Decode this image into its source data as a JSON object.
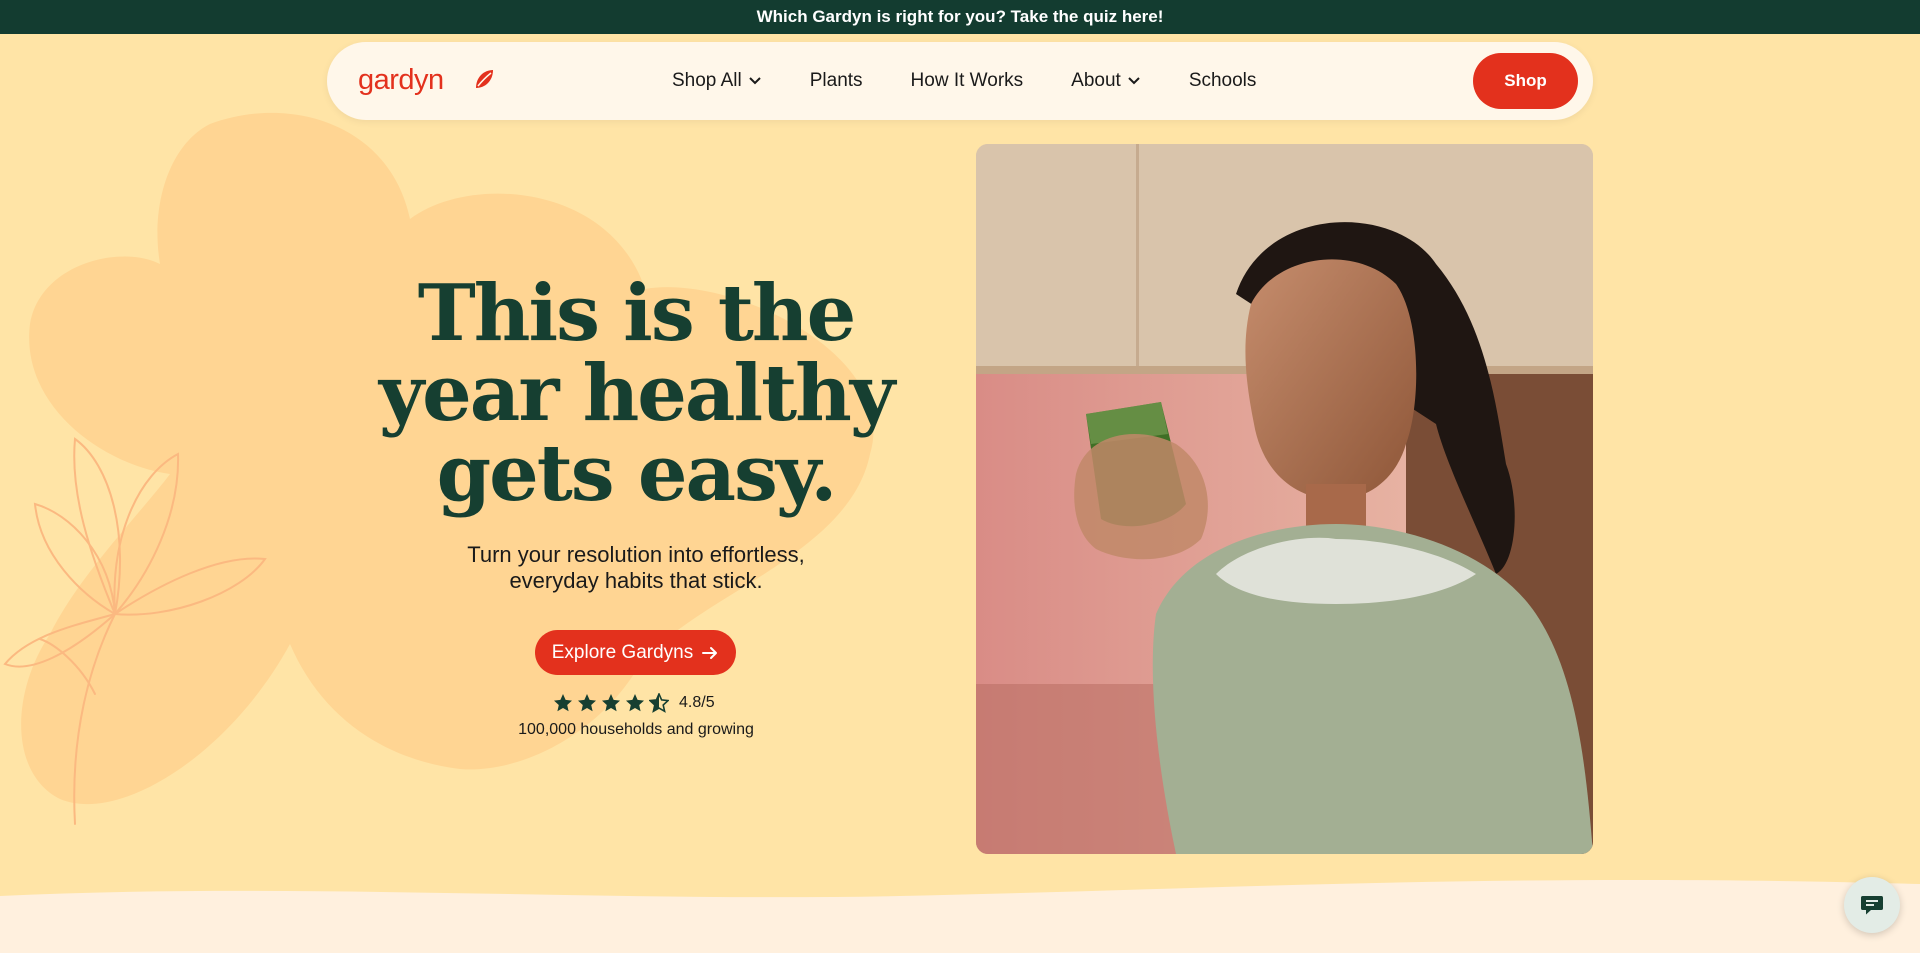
{
  "announcement": {
    "text": "Which Gardyn is right for you? Take the quiz here!"
  },
  "brand": {
    "name": "gardyn",
    "logo_color": "#e3311d"
  },
  "nav": {
    "items": [
      {
        "label": "Shop All",
        "has_dropdown": true
      },
      {
        "label": "Plants",
        "has_dropdown": false
      },
      {
        "label": "How It Works",
        "has_dropdown": false
      },
      {
        "label": "About",
        "has_dropdown": true
      },
      {
        "label": "Schools",
        "has_dropdown": false
      }
    ],
    "shop_button": "Shop"
  },
  "hero": {
    "title_lines": [
      "This is the",
      "year healthy",
      "gets easy."
    ],
    "subtitle_lines": [
      "Turn your resolution into effortless,",
      "everyday habits that stick."
    ],
    "cta_label": "Explore Gardyns",
    "rating": {
      "value": 4.8,
      "max": 5,
      "text": "4.8/5"
    },
    "households_text": "100,000 households and growing",
    "photo_icon": "woman-drinking-green-smoothie-photo"
  },
  "chat": {
    "icon": "chat-bubble-icon"
  },
  "colors": {
    "announcement_bg": "#133c30",
    "page_bg": "#ffe4a6",
    "nav_bg": "#fff7ea",
    "accent": "#e3311d",
    "heading": "#163f31",
    "star": "#163f31"
  }
}
